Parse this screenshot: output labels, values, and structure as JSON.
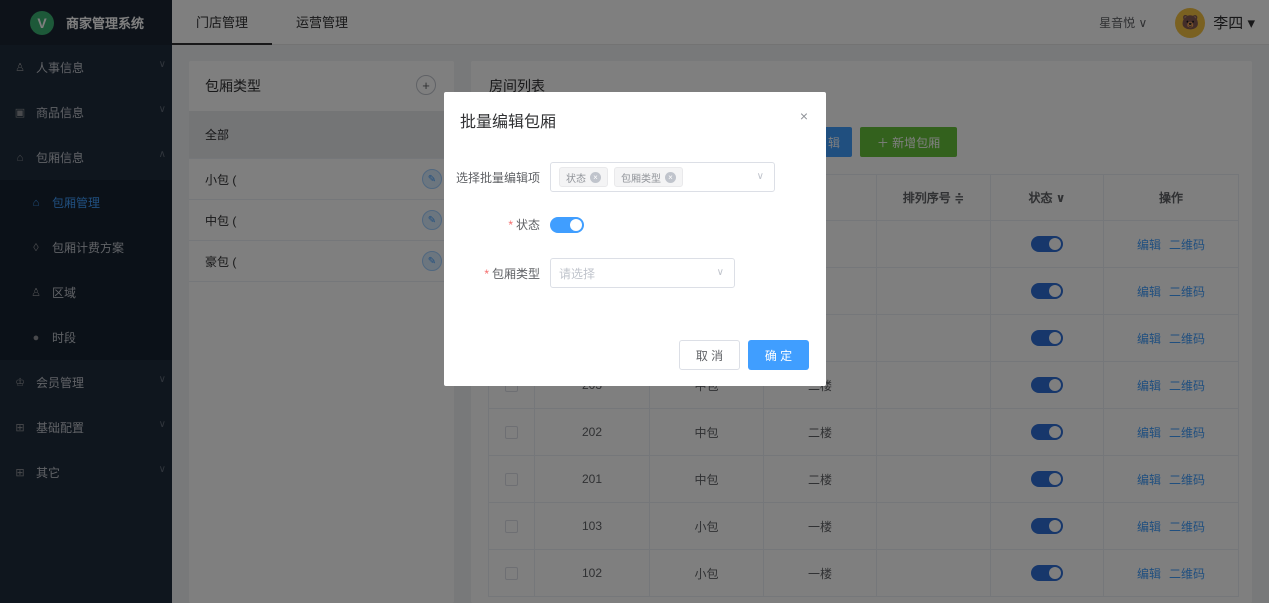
{
  "app": {
    "logo_letter": "V",
    "title": "商家管理系统"
  },
  "sidebar": {
    "items": [
      {
        "label": "人事信息",
        "icon": "person-icon"
      },
      {
        "label": "商品信息",
        "icon": "goods-icon"
      },
      {
        "label": "包厢信息",
        "icon": "home-icon"
      },
      {
        "label": "会员管理",
        "icon": "crown-icon"
      },
      {
        "label": "基础配置",
        "icon": "grid-icon"
      },
      {
        "label": "其它",
        "icon": "grid-icon"
      }
    ],
    "subitems": [
      {
        "label": "包厢管理",
        "icon": "home-icon",
        "active": true
      },
      {
        "label": "包厢计费方案",
        "icon": "shield-icon"
      },
      {
        "label": "区域",
        "icon": "person-icon"
      },
      {
        "label": "时段",
        "icon": "clock-icon"
      }
    ]
  },
  "topbar": {
    "tabs": [
      {
        "label": "门店管理"
      },
      {
        "label": "运营管理"
      }
    ],
    "store": "星音悦",
    "store_arrow": "∨",
    "user": "李四",
    "user_arrow": "▾"
  },
  "left_panel": {
    "title": "包厢类型",
    "all_label": "全部",
    "types": [
      "小包 (",
      "中包 (",
      "豪包 ("
    ]
  },
  "right_panel": {
    "title": "房间列表",
    "btn_batch": "辑",
    "btn_add": "＋ 新增包厢",
    "headers": [
      "",
      "",
      "",
      "∨",
      "排列序号 ≑",
      "状态 ∨",
      "操作"
    ],
    "rows": [
      {
        "room": "",
        "type": "",
        "floor": "楼"
      },
      {
        "room": "",
        "type": "",
        "floor": "楼"
      },
      {
        "room": "",
        "type": "",
        "floor": "楼"
      },
      {
        "room": "203",
        "type": "中包",
        "floor": "二楼"
      },
      {
        "room": "202",
        "type": "中包",
        "floor": "二楼"
      },
      {
        "room": "201",
        "type": "中包",
        "floor": "二楼"
      },
      {
        "room": "103",
        "type": "小包",
        "floor": "一楼"
      },
      {
        "room": "102",
        "type": "小包",
        "floor": "一楼"
      }
    ],
    "action_edit": "编辑",
    "action_qr": "二维码"
  },
  "dialog": {
    "title": "批量编辑包厢",
    "close": "×",
    "field1_label": "选择批量编辑项",
    "field1_tags": [
      "状态",
      "包厢类型"
    ],
    "field2_label": "状态",
    "field2_value": true,
    "field3_label": "包厢类型",
    "field3_placeholder": "请选择",
    "cancel": "取 消",
    "ok": "确 定"
  }
}
